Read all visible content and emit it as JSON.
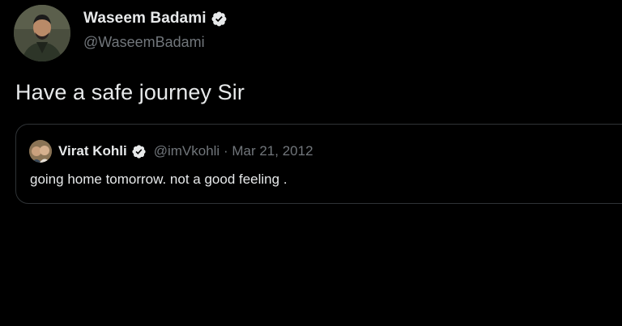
{
  "tweet": {
    "author": {
      "display_name": "Waseem Badami",
      "handle": "@WaseemBadami",
      "verified": true
    },
    "text": "Have a safe journey Sir",
    "quoted": {
      "author": {
        "display_name": "Virat Kohli",
        "handle": "@imVkohli",
        "verified": true
      },
      "separator": "·",
      "date": "Mar 21, 2012",
      "text": "going home tomorrow. not a good feeling ."
    }
  },
  "colors": {
    "background": "#000000",
    "primary_text": "#e7e9ea",
    "secondary_text": "#71767b",
    "border": "#2f3336"
  },
  "icons": {
    "verified": "verified-badge-icon"
  }
}
